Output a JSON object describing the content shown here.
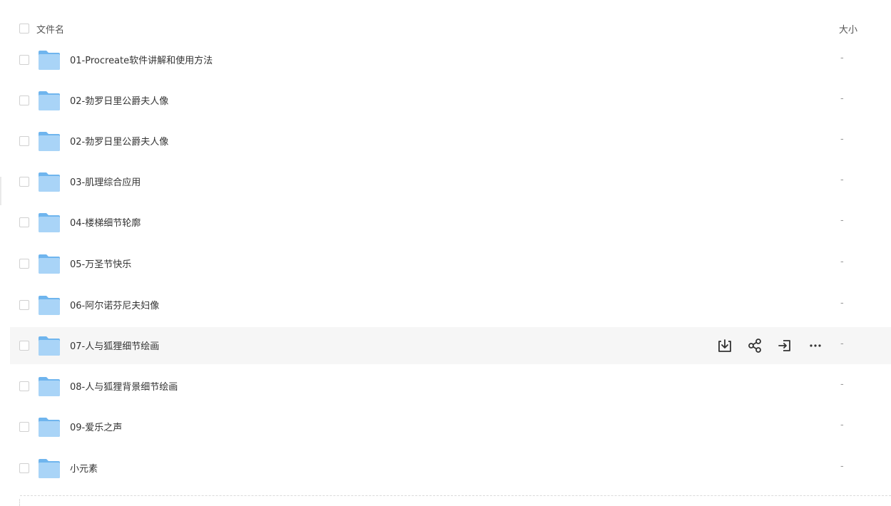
{
  "header": {
    "name_label": "文件名",
    "size_label": "大小"
  },
  "rows": [
    {
      "name": "01-Procreate软件讲解和使用方法",
      "size": "-"
    },
    {
      "name": "02-勃罗日里公爵夫人像",
      "size": "-"
    },
    {
      "name": "02-勃罗日里公爵夫人像",
      "size": "-"
    },
    {
      "name": "03-肌理综合应用",
      "size": "-"
    },
    {
      "name": "04-楼梯细节轮廓",
      "size": "-"
    },
    {
      "name": "05-万圣节快乐",
      "size": "-"
    },
    {
      "name": "06-阿尔诺芬尼夫妇像",
      "size": "-"
    },
    {
      "name": "07-人与狐狸细节绘画",
      "size": "-"
    },
    {
      "name": "08-人与狐狸背景细节绘画",
      "size": "-"
    },
    {
      "name": "09-爱乐之声",
      "size": "-"
    },
    {
      "name": "小元素",
      "size": "-"
    }
  ],
  "hovered_row_actions": [
    "download-icon",
    "share-icon",
    "move-icon",
    "more-icon"
  ],
  "colors": {
    "folder_light": "#a9d4f7",
    "folder_dark": "#6fb5ee",
    "hover_bg": "#f6f6f6"
  }
}
